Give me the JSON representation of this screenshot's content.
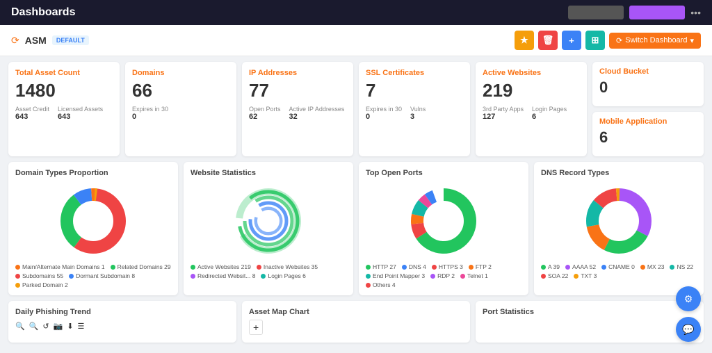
{
  "topNav": {
    "title": "Dashboards"
  },
  "subHeader": {
    "asmLabel": "ASM",
    "defaultBadge": "DEFAULT",
    "buttons": [
      {
        "label": "★",
        "class": "btn-yellow",
        "name": "star-btn"
      },
      {
        "label": "🗑",
        "class": "btn-red",
        "name": "delete-btn"
      },
      {
        "label": "+",
        "class": "btn-blue",
        "name": "add-btn"
      },
      {
        "label": "⊞",
        "class": "btn-teal",
        "name": "grid-btn"
      }
    ],
    "switchLabel": "Switch Dashboard"
  },
  "stats": [
    {
      "id": "total-asset",
      "title": "Total Asset Count",
      "value": "1480",
      "subs": [
        {
          "label": "Asset Credit",
          "value": "643"
        },
        {
          "label": "Licensed Assets",
          "value": "643"
        }
      ]
    },
    {
      "id": "domains",
      "title": "Domains",
      "value": "66",
      "subs": [
        {
          "label": "Expires in 30",
          "value": "0"
        }
      ]
    },
    {
      "id": "ip-addresses",
      "title": "IP Addresses",
      "value": "77",
      "subs": [
        {
          "label": "Open Ports",
          "value": "62"
        },
        {
          "label": "Active IP Addresses",
          "value": "32"
        }
      ]
    },
    {
      "id": "ssl-certificates",
      "title": "SSL Certificates",
      "value": "7",
      "subs": [
        {
          "label": "Expires in 30",
          "value": "0"
        },
        {
          "label": "Vulns",
          "value": "3"
        }
      ]
    },
    {
      "id": "active-websites",
      "title": "Active Websites",
      "value": "219",
      "subs": [
        {
          "label": "3rd Party Apps",
          "value": "127"
        },
        {
          "label": "Login Pages",
          "value": "6"
        }
      ]
    },
    {
      "id": "cloud-bucket",
      "title": "Cloud Bucket",
      "value": "0",
      "subs": []
    }
  ],
  "statsMobile": {
    "title": "Mobile Application",
    "value": "6"
  },
  "charts": [
    {
      "id": "domain-types",
      "title": "Domain Types Proportion",
      "legend": [
        {
          "color": "#f97316",
          "label": "Main/Alternate Main Domains",
          "value": "1"
        },
        {
          "color": "#22c55e",
          "label": "Related Domains",
          "value": "29"
        },
        {
          "color": "#ef4444",
          "label": "Subdomains",
          "value": "55"
        },
        {
          "color": "#3b82f6",
          "label": "Dormant Subdomain",
          "value": "8"
        },
        {
          "color": "#f59e0b",
          "label": "Parked Domain",
          "value": "2"
        }
      ]
    },
    {
      "id": "website-stats",
      "title": "Website Statistics",
      "legend": [
        {
          "color": "#22c55e",
          "label": "Active Websites",
          "value": "219"
        },
        {
          "color": "#ef4444",
          "label": "Inactive Websites",
          "value": "35"
        },
        {
          "color": "#a855f7",
          "label": "Redirected Websit...",
          "value": "8"
        },
        {
          "color": "#14b8a6",
          "label": "Login Pages",
          "value": "6"
        }
      ]
    },
    {
      "id": "top-open-ports",
      "title": "Top Open Ports",
      "legend": [
        {
          "color": "#22c55e",
          "label": "HTTP",
          "value": "27"
        },
        {
          "color": "#3b82f6",
          "label": "DNS",
          "value": "4"
        },
        {
          "color": "#ef4444",
          "label": "HTTPS",
          "value": "3"
        },
        {
          "color": "#f97316",
          "label": "FTP",
          "value": "2"
        },
        {
          "color": "#14b8a6",
          "label": "End Point Mapper",
          "value": "3"
        },
        {
          "color": "#a855f7",
          "label": "RDP",
          "value": "2"
        },
        {
          "color": "#ec4899",
          "label": "Telnet",
          "value": "1"
        },
        {
          "color": "#ef4444",
          "label": "Others",
          "value": "4"
        }
      ]
    },
    {
      "id": "dns-record-types",
      "title": "DNS Record Types",
      "legend": [
        {
          "color": "#22c55e",
          "label": "A",
          "value": "39"
        },
        {
          "color": "#a855f7",
          "label": "AAAA",
          "value": "52"
        },
        {
          "color": "#3b82f6",
          "label": "CNAME",
          "value": "0"
        },
        {
          "color": "#f97316",
          "label": "MX",
          "value": "23"
        },
        {
          "color": "#14b8a6",
          "label": "NS",
          "value": "22"
        },
        {
          "color": "#ef4444",
          "label": "SOA",
          "value": "22"
        },
        {
          "color": "#f59e0b",
          "label": "TXT",
          "value": "3"
        }
      ]
    }
  ],
  "bottomCards": [
    {
      "id": "daily-phishing",
      "title": "Daily Phishing Trend"
    },
    {
      "id": "asset-map",
      "title": "Asset Map Chart"
    },
    {
      "id": "port-statistics",
      "title": "Port Statistics"
    }
  ],
  "floatingButtons": [
    {
      "name": "settings-float-btn",
      "icon": "⚙"
    },
    {
      "name": "chat-float-btn",
      "icon": "💬"
    }
  ]
}
